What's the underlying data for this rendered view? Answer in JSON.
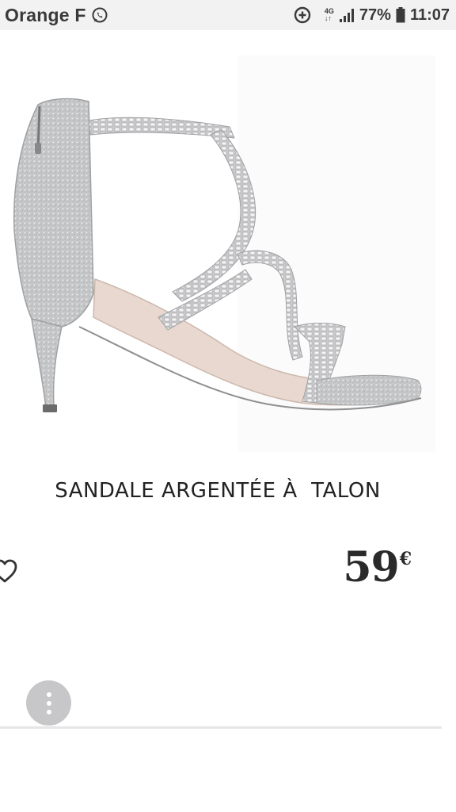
{
  "status_bar": {
    "carrier": "Orange F",
    "network_type_top": "4G",
    "network_type_bottom": "↓↑",
    "battery": "77%",
    "time": "11:07",
    "icons": [
      "whatsapp-icon",
      "data-saver-icon",
      "signal-icon",
      "battery-icon"
    ]
  },
  "product": {
    "image_icon": "silver-sandal-image",
    "title": "SANDALE ARGENTÉE À  TALON",
    "price_amount": "59",
    "price_currency": "€"
  },
  "actions": {
    "wishlist_icon": "heart-outline-icon",
    "more_icon": "more-vertical-icon"
  },
  "colors": {
    "status_bar_bg": "#f2f2f2",
    "text": "#222222",
    "more_button_bg": "#c7c7c9"
  }
}
